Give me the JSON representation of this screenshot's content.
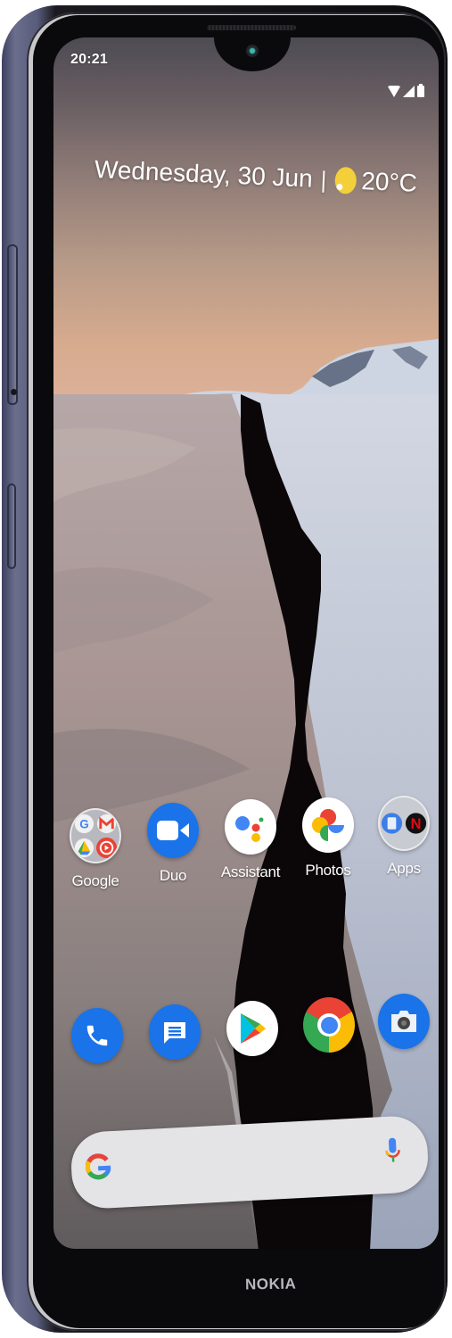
{
  "device": {
    "brand_label": "NOKIA"
  },
  "status_bar": {
    "time": "20:21",
    "icons": [
      "wifi-icon",
      "cellular-signal-icon",
      "battery-icon"
    ]
  },
  "glance_widget": {
    "date": "Wednesday, 30 Jun",
    "separator": "|",
    "weather_icon": "partly-sunny-icon",
    "temperature": "20°C"
  },
  "home_row": [
    {
      "label": "Google",
      "icon": "google-folder-icon",
      "type": "folder",
      "contents": [
        "Google",
        "Gmail",
        "Drive",
        "YouTube Music"
      ]
    },
    {
      "label": "Duo",
      "icon": "duo-icon",
      "color": "#1a73e8"
    },
    {
      "label": "Assistant",
      "icon": "assistant-icon"
    },
    {
      "label": "Photos",
      "icon": "photos-icon"
    },
    {
      "label": "Apps",
      "icon": "apps-folder-icon",
      "type": "folder",
      "contents": [
        "Files",
        "Netflix"
      ]
    }
  ],
  "dock": [
    {
      "label": "Phone",
      "icon": "phone-icon",
      "color": "#1a73e8"
    },
    {
      "label": "Messages",
      "icon": "messages-icon",
      "color": "#1a73e8"
    },
    {
      "label": "Play Store",
      "icon": "play-store-icon"
    },
    {
      "label": "Chrome",
      "icon": "chrome-icon"
    },
    {
      "label": "Camera",
      "icon": "camera-icon",
      "color": "#1a73e8"
    }
  ],
  "search_bar": {
    "logo": "google-g-icon",
    "mic": "mic-icon",
    "placeholder": ""
  },
  "colors": {
    "google_blue": "#4285f4",
    "google_red": "#ea4335",
    "google_yellow": "#fbbc05",
    "google_green": "#34a853",
    "frame": "#585b7a"
  }
}
